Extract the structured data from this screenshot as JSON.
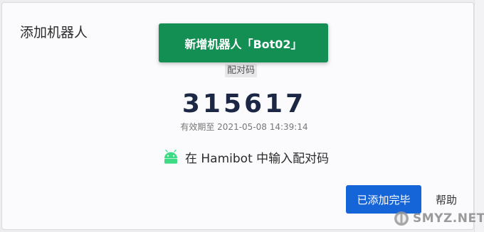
{
  "dialog": {
    "title": "添加机器人"
  },
  "toast": {
    "message": "新增机器人「Bot02」",
    "color": "#138f54"
  },
  "pairing": {
    "label": "配对码",
    "code": "315617",
    "expiry": "有效期至 2021-05-08 14:39:14"
  },
  "instruction": {
    "icon": "android-icon",
    "text": "在 Hamibot 中输入配对码"
  },
  "actions": {
    "done_label": "已添加完毕",
    "help_label": "帮助",
    "primary_color": "#1565d8"
  },
  "watermark": {
    "text": "SMYZ.NET"
  }
}
